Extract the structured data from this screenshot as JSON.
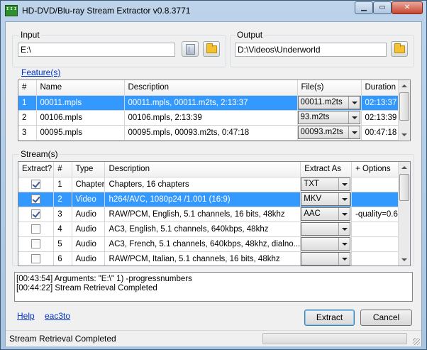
{
  "window": {
    "title": "HD-DVD/Blu-ray Stream Extractor v0.8.3771",
    "app_icon_text": "ᴵᴵᴵ"
  },
  "input": {
    "label": "Input",
    "value": "E:\\"
  },
  "output": {
    "label": "Output",
    "value": "D:\\Videos\\Underworld"
  },
  "features": {
    "label": "Feature(s)",
    "columns": [
      "#",
      "Name",
      "Description",
      "File(s)",
      "Duration"
    ],
    "rows": [
      {
        "num": "1",
        "name": "00011.mpls",
        "description": "00011.mpls, 00011.m2ts, 2:13:37",
        "file": "00011.m2ts",
        "duration": "02:13:37",
        "selected": true
      },
      {
        "num": "2",
        "name": "00106.mpls",
        "description": "00106.mpls, 2:13:39",
        "file": "93.m2ts",
        "duration": "02:13:39",
        "selected": false
      },
      {
        "num": "3",
        "name": "00095.mpls",
        "description": "00095.mpls, 00093.m2ts, 0:47:18",
        "file": "00093.m2ts",
        "duration": "00:47:18",
        "selected": false
      }
    ]
  },
  "streams": {
    "label": "Stream(s)",
    "columns": [
      "Extract?",
      "#",
      "Type",
      "Description",
      "Extract As",
      "+ Options"
    ],
    "rows": [
      {
        "checked": true,
        "num": "1",
        "type": "Chapter",
        "description": "Chapters, 16 chapters",
        "extract_as": "TXT",
        "options": "",
        "selected": false
      },
      {
        "checked": true,
        "num": "2",
        "type": "Video",
        "description": "h264/AVC, 1080p24 /1.001 (16:9)",
        "extract_as": "MKV",
        "options": "",
        "selected": true
      },
      {
        "checked": true,
        "num": "3",
        "type": "Audio",
        "description": "RAW/PCM, English, 5.1 channels, 16 bits, 48khz",
        "extract_as": "AAC",
        "options": "-quality=0.6",
        "selected": false
      },
      {
        "checked": false,
        "num": "4",
        "type": "Audio",
        "description": "AC3, English, 5.1 channels, 640kbps, 48khz",
        "extract_as": "",
        "options": "",
        "selected": false
      },
      {
        "checked": false,
        "num": "5",
        "type": "Audio",
        "description": "AC3, French, 5.1 channels, 640kbps, 48khz, dialno...",
        "extract_as": "",
        "options": "",
        "selected": false
      },
      {
        "checked": false,
        "num": "6",
        "type": "Audio",
        "description": "RAW/PCM, Italian, 5.1 channels, 16 bits, 48khz",
        "extract_as": "",
        "options": "",
        "selected": false
      }
    ]
  },
  "log": {
    "lines": [
      "[00:43:54] Arguments: \"E:\\\" 1) -progressnumbers",
      "[00:44:22] Stream Retrieval Completed"
    ]
  },
  "links": {
    "help": "Help",
    "eac3to": "eac3to"
  },
  "buttons": {
    "extract": "Extract",
    "cancel": "Cancel",
    "minimize": "▁",
    "maximize": "▭",
    "close": "✕"
  },
  "status": {
    "text": "Stream Retrieval Completed",
    "progress_fraction": 0
  },
  "colors": {
    "selection": "#3399ff",
    "link": "#0033cc",
    "window_frame": "#a9c4e0"
  }
}
